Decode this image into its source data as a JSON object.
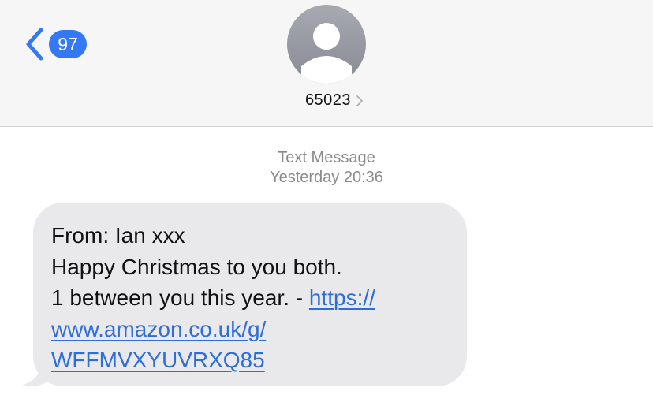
{
  "header": {
    "back_badge_count": "97",
    "contact_name": "65023",
    "accent_color": "#3478f6",
    "icons": {
      "back": "chevron-left-icon",
      "avatar": "person-silhouette-icon",
      "contact_detail": "chevron-right-icon"
    }
  },
  "conversation": {
    "timestamp_label": "Text Message",
    "timestamp_day": "Yesterday",
    "timestamp_time": "20:36",
    "message": {
      "line1": "From: Ian xxx",
      "line2": "Happy Christmas to you both.",
      "line3_text": "1 between you this year. - ",
      "link_part1": "https://",
      "link_part2": "www.amazon.co.uk/g/",
      "link_part3": "WFFMVXYUVRXQ85",
      "bubble_color": "#e9e9eb",
      "link_color": "#2f6ed8"
    }
  }
}
